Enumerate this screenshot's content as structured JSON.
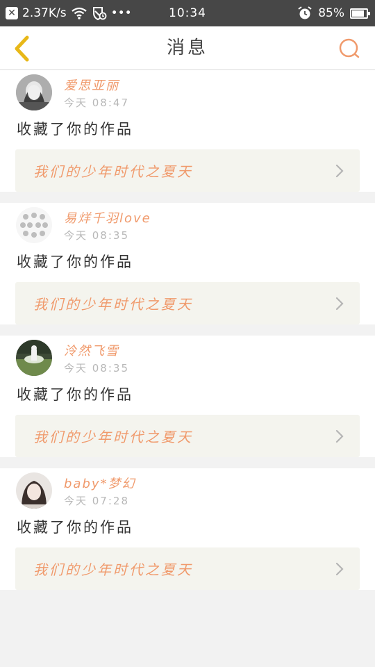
{
  "status_bar": {
    "speed": "2.37K/s",
    "more": "•••",
    "time": "10:34",
    "battery": "85%",
    "battery_level": 0.85
  },
  "header": {
    "title": "消息",
    "back_icon": "chevron-left-icon",
    "search_icon": "search-icon",
    "accent_color": "#f0c020",
    "search_color": "#f09a6c"
  },
  "messages": [
    {
      "user": "爱思亚丽",
      "time": "今天 08:47",
      "action": "收藏了你的作品",
      "work": "我们的少年时代之夏天"
    },
    {
      "user": "易烊千羽love",
      "time": "今天 08:35",
      "action": "收藏了你的作品",
      "work": "我们的少年时代之夏天"
    },
    {
      "user": "泠然飞雪",
      "time": "今天 08:35",
      "action": "收藏了你的作品",
      "work": "我们的少年时代之夏天"
    },
    {
      "user": "baby*梦幻",
      "time": "今天 07:28",
      "action": "收藏了你的作品",
      "work": "我们的少年时代之夏天"
    }
  ]
}
